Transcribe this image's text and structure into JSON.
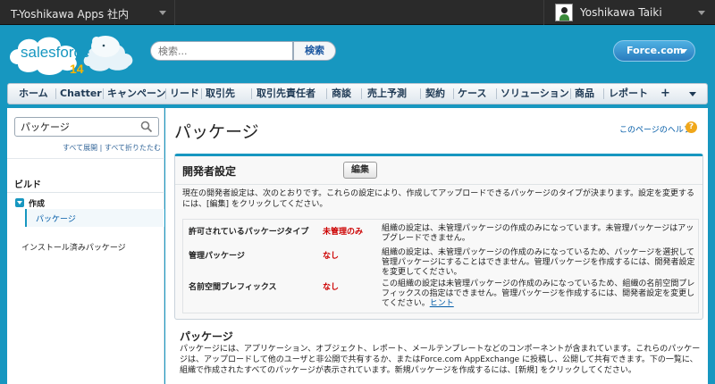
{
  "topbar": {
    "org_name": "T-Yoshikawa Apps 社内",
    "user_name": "Yoshikawa Taiki"
  },
  "header": {
    "logo_text": "salesforce",
    "logo_version": "14",
    "search_placeholder": "検索...",
    "search_button": "検索",
    "app_switcher": "Force.com"
  },
  "tabs": [
    "ホーム",
    "Chatter",
    "キャンペーン",
    "リード",
    "取引先",
    "取引先責任者",
    "商談",
    "売上予測",
    "契約",
    "ケース",
    "ソリューション",
    "商品",
    "レポート"
  ],
  "tab_plus": "+",
  "sidebar": {
    "search_value": "パッケージ",
    "expand_all": "すべて展開",
    "collapse_all": "すべて折りたたむ",
    "separator": "|",
    "section_heading": "ビルド",
    "tree_group": "作成",
    "tree_child": "パッケージ",
    "installed_link": "インストール済みパッケージ"
  },
  "main": {
    "page_title": "パッケージ",
    "help_link": "このページのヘルプ",
    "help_icon": "?",
    "panel": {
      "title": "開発者設定",
      "edit_button": "編集",
      "description": "現在の開発者設定は、次のとおりです。これらの設定により、作成してアップロードできるパッケージのタイプが決まります。設定を変更するには、[編集] をクリックしてください。",
      "rows": [
        {
          "label": "許可されているパッケージタイプ",
          "value": "未管理のみ",
          "desc": "組織の設定は、未管理パッケージの作成のみになっています。未管理パッケージはアップグレードできません。"
        },
        {
          "label": "管理パッケージ",
          "value": "なし",
          "desc": "組織の設定は、未管理パッケージの作成のみになっているため、パッケージを選択して管理パッケージにすることはできません。管理パッケージを作成するには、開発者設定を変更してください。"
        },
        {
          "label": "名前空間プレフィックス",
          "value": "なし",
          "desc": "この組織の設定は未管理パッケージの作成のみになっているため、組織の名前空間プレフィックスの指定はできません。管理パッケージを作成するには、開発者設定を変更してください。",
          "link": "ヒント"
        }
      ]
    },
    "section2": {
      "title": "パッケージ",
      "description": "パッケージには、アプリケーション、オブジェクト、レポート、メールテンプレートなどのコンポーネントが含まれています。これらのパッケージは、アップロードして他のユーザと非公開で共有するか、またはForce.com AppExchange に投稿し、公開して共有できます。下の一覧に、組織で作成されたすべてのパッケージが表示されています。新規パッケージを作成するには、[新規] をクリックしてください。"
    }
  },
  "colors": {
    "brand_blue": "#1797c0",
    "top_bar": "#2a2a2a",
    "alert_red": "#cc0000",
    "link_blue": "#015ba7"
  }
}
